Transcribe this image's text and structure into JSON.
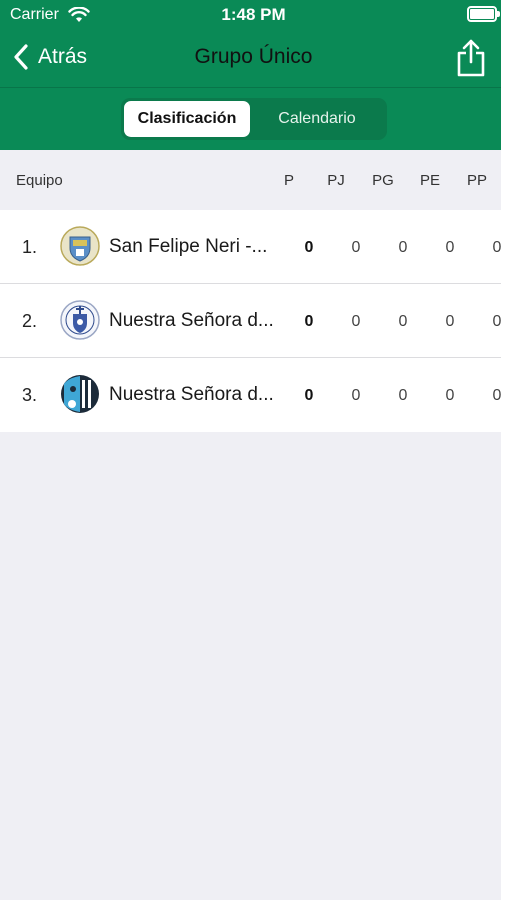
{
  "status_bar": {
    "carrier": "Carrier",
    "time": "1:48 PM"
  },
  "nav": {
    "back_label": "Atrás",
    "title": "Grupo Único"
  },
  "segments": [
    {
      "label": "Clasificación",
      "selected": true
    },
    {
      "label": "Calendario",
      "selected": false
    }
  ],
  "table": {
    "columns": [
      "Equipo",
      "P",
      "PJ",
      "PG",
      "PE",
      "PP"
    ],
    "rows": [
      {
        "rank": "1.",
        "team": "San Felipe Neri -...",
        "P": "0",
        "PJ": "0",
        "PG": "0",
        "PE": "0",
        "PP": "0"
      },
      {
        "rank": "2.",
        "team": "Nuestra Señora d...",
        "P": "0",
        "PJ": "0",
        "PG": "0",
        "PE": "0",
        "PP": "0"
      },
      {
        "rank": "3.",
        "team": "Nuestra Señora d...",
        "P": "0",
        "PJ": "0",
        "PG": "0",
        "PE": "0",
        "PP": "0"
      }
    ]
  },
  "colors": {
    "brand_green": "#0a8a56",
    "background": "#efeff4"
  },
  "icons": [
    "wifi-icon",
    "battery-icon",
    "chevron-left-icon",
    "share-icon",
    "team-crest-icon"
  ]
}
